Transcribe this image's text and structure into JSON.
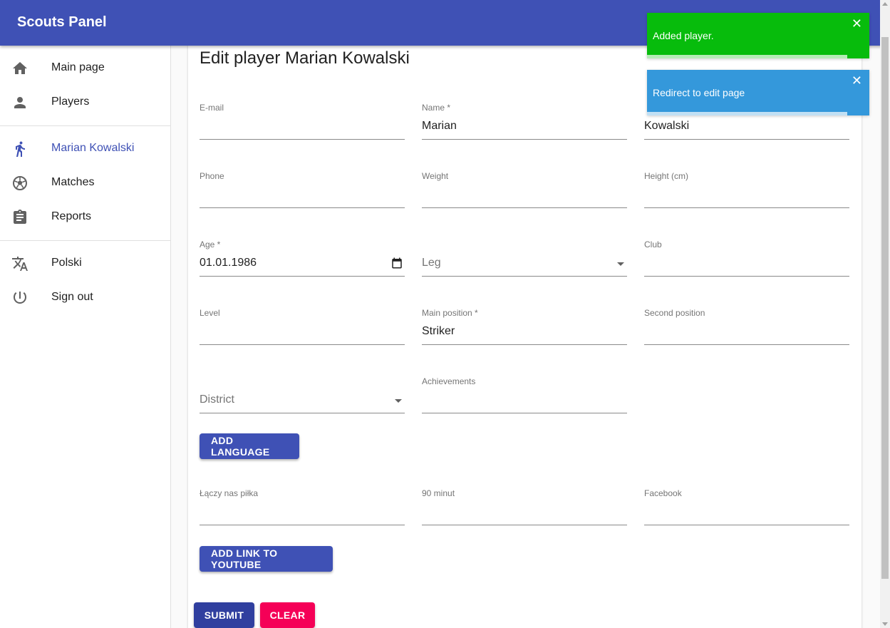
{
  "app": {
    "title": "Scouts Panel"
  },
  "nav": {
    "main_page": "Main page",
    "players": "Players",
    "player_name": "Marian Kowalski",
    "matches": "Matches",
    "reports": "Reports",
    "language": "Polski",
    "sign_out": "Sign out"
  },
  "page": {
    "title": "Edit player Marian Kowalski"
  },
  "form": {
    "email": {
      "label": "E-mail",
      "value": ""
    },
    "name": {
      "label": "Name *",
      "value": "Marian"
    },
    "surname": {
      "value": "Kowalski"
    },
    "phone": {
      "label": "Phone",
      "value": ""
    },
    "weight": {
      "label": "Weight",
      "value": ""
    },
    "height": {
      "label": "Height (cm)",
      "value": ""
    },
    "age": {
      "label": "Age *",
      "value": "01.01.1986"
    },
    "leg": {
      "placeholder": "Leg"
    },
    "club": {
      "label": "Club",
      "value": ""
    },
    "level": {
      "label": "Level",
      "value": ""
    },
    "main_position": {
      "label": "Main position *",
      "value": "Striker"
    },
    "second_position": {
      "label": "Second position",
      "value": ""
    },
    "district": {
      "placeholder": "District"
    },
    "achievements": {
      "label": "Achievements",
      "value": ""
    },
    "add_language": "ADD LANGUAGE",
    "laczy_nas_pilka": {
      "label": "Łączy nas piłka",
      "value": ""
    },
    "ninety_minut": {
      "label": "90 minut",
      "value": ""
    },
    "facebook": {
      "label": "Facebook",
      "value": ""
    },
    "add_youtube": "ADD LINK TO YOUTUBE",
    "submit": "SUBMIT",
    "clear": "CLEAR"
  },
  "toasts": [
    {
      "text": "Added player.",
      "close": "✕",
      "progress": 0.9
    },
    {
      "text": "Redirect to edit page",
      "close": "✕",
      "progress": 0.9
    }
  ],
  "colors": {
    "primary": "#3f51b5",
    "primary_dark": "#303f9f",
    "secondary": "#f50057",
    "toast_success": "#07bc0c",
    "toast_info": "#3498db"
  },
  "icons": {
    "main_page": "home-icon",
    "players": "person-icon",
    "player": "runner-icon",
    "matches": "soccer-ball-icon",
    "reports": "clipboard-icon",
    "language": "translate-icon",
    "sign_out": "power-icon",
    "age": "calendar-icon"
  }
}
